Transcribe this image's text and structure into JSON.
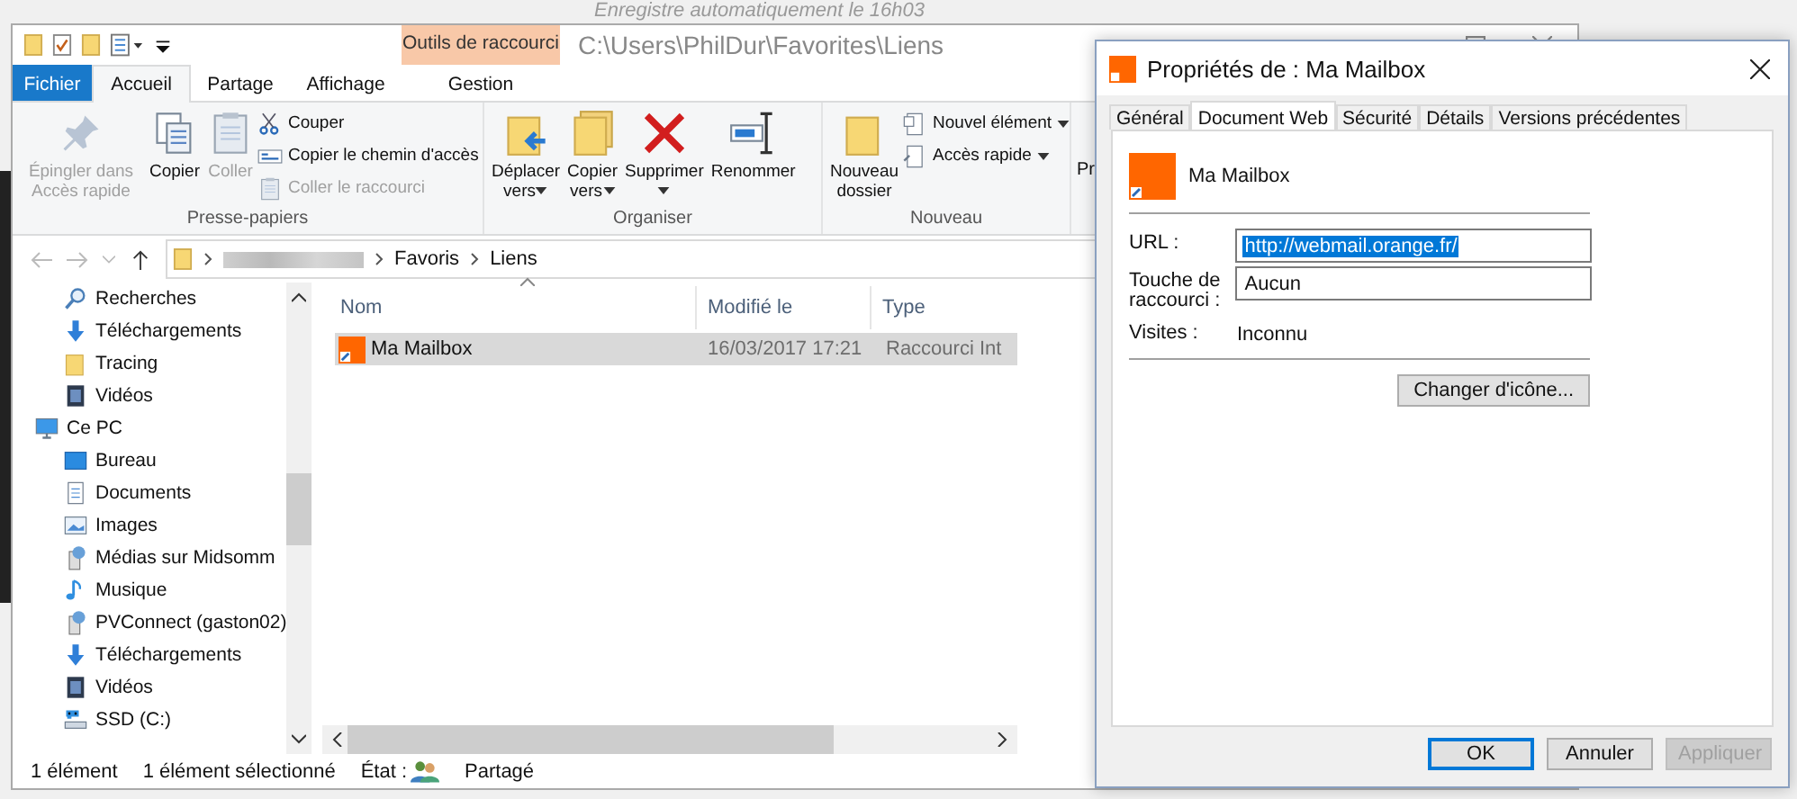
{
  "background_text": "Enregistre automatiquement le 16h03",
  "explorer": {
    "context_tab": "Outils de raccourci",
    "path": "C:\\Users\\PhilDur\\Favorites\\Liens",
    "tabs": [
      {
        "label": "Fichier",
        "kind": "file",
        "selected": false
      },
      {
        "label": "Accueil",
        "kind": "normal",
        "selected": true
      },
      {
        "label": "Partage",
        "kind": "normal",
        "selected": false
      },
      {
        "label": "Affichage",
        "kind": "normal",
        "selected": false
      },
      {
        "label": "Gestion",
        "kind": "context",
        "selected": false
      }
    ],
    "ribbon_groups": [
      {
        "label": "Presse-papiers",
        "items": [
          {
            "label": "Épingler dans Accès rapide",
            "kind": "large",
            "disabled": true,
            "dropdown": false
          },
          {
            "label": "Copier",
            "kind": "large",
            "disabled": false,
            "dropdown": false
          },
          {
            "label": "Coller",
            "kind": "large",
            "disabled": true,
            "dropdown": false
          },
          {
            "label": "Couper",
            "kind": "small",
            "disabled": false,
            "dropdown": false
          },
          {
            "label": "Copier le chemin d'accès",
            "kind": "small",
            "disabled": false,
            "dropdown": false
          },
          {
            "label": "Coller le raccourci",
            "kind": "small",
            "disabled": true,
            "dropdown": false
          }
        ]
      },
      {
        "label": "Organiser",
        "items": [
          {
            "label": "Déplacer vers",
            "kind": "large",
            "disabled": false,
            "dropdown": true
          },
          {
            "label": "Copier vers",
            "kind": "large",
            "disabled": false,
            "dropdown": true
          },
          {
            "label": "Supprimer",
            "kind": "large",
            "disabled": false,
            "dropdown": true
          },
          {
            "label": "Renommer",
            "kind": "large",
            "disabled": false,
            "dropdown": false
          }
        ]
      },
      {
        "label": "Nouveau",
        "items": [
          {
            "label": "Nouveau dossier",
            "kind": "large",
            "disabled": false,
            "dropdown": false
          },
          {
            "label": "Nouvel élément",
            "kind": "small",
            "disabled": false,
            "dropdown": true
          },
          {
            "label": "Accès rapide",
            "kind": "small",
            "disabled": false,
            "dropdown": true
          }
        ]
      }
    ],
    "partial_ribbon_text": "Pr",
    "breadcrumb": [
      "Favoris",
      "Liens"
    ],
    "nav_continued": [
      {
        "label": "Recherches"
      },
      {
        "label": "Téléchargements"
      },
      {
        "label": "Tracing"
      },
      {
        "label": "Vidéos"
      }
    ],
    "nav_items": [
      {
        "label": "Ce PC",
        "children": [
          {
            "label": "Bureau"
          },
          {
            "label": "Documents"
          },
          {
            "label": "Images"
          },
          {
            "label": "Médias sur Midsomm"
          },
          {
            "label": "Musique"
          },
          {
            "label": "PVConnect (gaston02)"
          },
          {
            "label": "Téléchargements"
          },
          {
            "label": "Vidéos"
          },
          {
            "label": "SSD (C:)"
          }
        ]
      }
    ],
    "columns": [
      "Nom",
      "Modifié le",
      "Type"
    ],
    "rows": [
      {
        "name": "Ma Mailbox",
        "modified": "16/03/2017 17:21",
        "type": "Raccourci Int",
        "selected": true
      }
    ],
    "status": {
      "count": "1 élément",
      "selection": "1 élément sélectionné",
      "state_label": "État :",
      "state": "Partagé"
    }
  },
  "dialog": {
    "title": "Propriétés de : Ma Mailbox",
    "tabs": [
      {
        "label": "Général",
        "selected": false
      },
      {
        "label": "Document Web",
        "selected": true
      },
      {
        "label": "Sécurité",
        "selected": false
      },
      {
        "label": "Détails",
        "selected": false
      },
      {
        "label": "Versions précédentes",
        "selected": false
      }
    ],
    "name": "Ma Mailbox",
    "fields": [
      {
        "label": "URL :",
        "value": "http://webmail.orange.fr/",
        "highlighted": true
      },
      {
        "label": "Touche de raccourci :",
        "value": "Aucun",
        "highlighted": false
      }
    ],
    "visits_label": "Visites :",
    "visits": "Inconnu",
    "change_icon_button": "Changer d'icône...",
    "buttons": [
      {
        "label": "OK",
        "kind": "default"
      },
      {
        "label": "Annuler",
        "kind": "normal"
      },
      {
        "label": "Appliquer",
        "kind": "disabled"
      }
    ]
  }
}
